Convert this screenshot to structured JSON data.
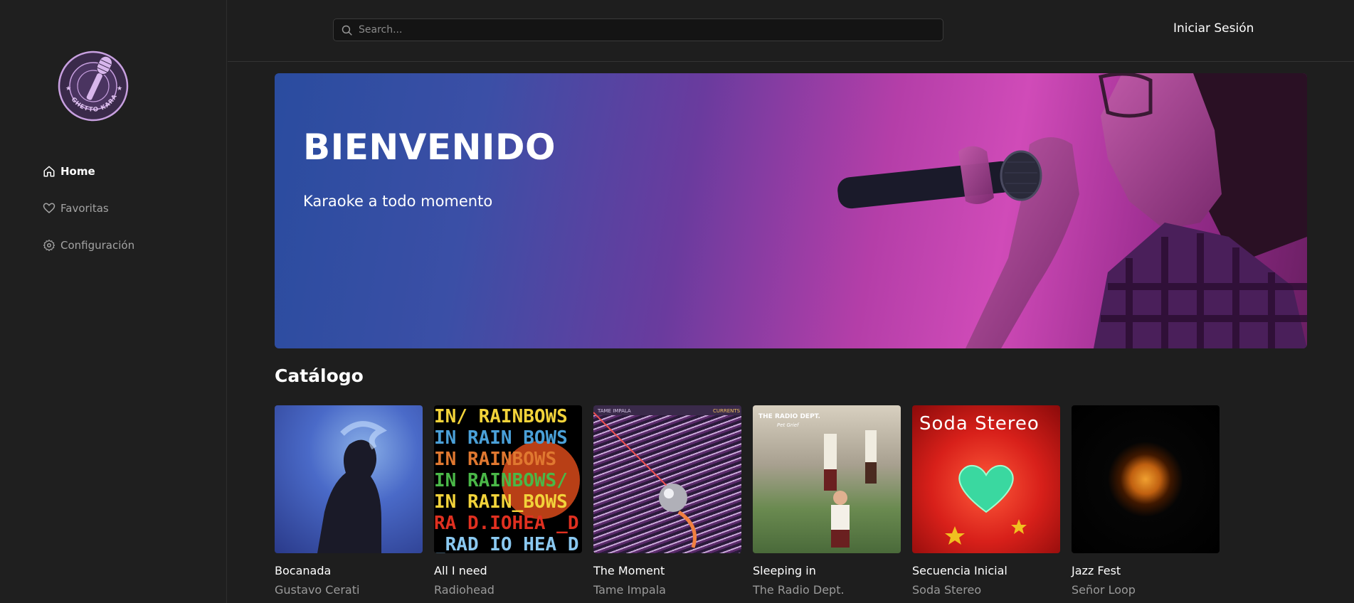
{
  "logo": {
    "ring_text": "GHETTO KARAOKE",
    "icon": "microphone-logo"
  },
  "sidebar": {
    "items": [
      {
        "label": "Home",
        "icon": "home-icon",
        "active": true
      },
      {
        "label": "Favoritas",
        "icon": "heart-icon",
        "active": false
      },
      {
        "label": "Configuración",
        "icon": "gear-icon",
        "active": false
      }
    ]
  },
  "header": {
    "search_placeholder": "Search...",
    "login_label": "Iniciar Sesión"
  },
  "hero": {
    "title": "BIENVENIDO",
    "subtitle": "Karaoke a todo momento"
  },
  "catalog": {
    "title": "Catálogo",
    "albums": [
      {
        "title": "Bocanada",
        "artist": "Gustavo Cerati"
      },
      {
        "title": "All I need",
        "artist": "Radiohead",
        "cover_text": [
          "IN/ RAINBOWS",
          "IN RAIN BOWS",
          "IN RAINBOWS",
          "IN RAINBOWS/",
          "IN RAIN_BOWS",
          "RA D.IOHEA _D",
          "_RAD IO HEA D"
        ]
      },
      {
        "title": "The Moment",
        "artist": "Tame Impala",
        "cover_text": [
          "TAME IMPALA",
          "CURRENTS"
        ]
      },
      {
        "title": "Sleeping in",
        "artist": "The Radio Dept.",
        "cover_text": [
          "THE RADIO DEPT.",
          "Pet Grief"
        ]
      },
      {
        "title": "Secuencia Inicial",
        "artist": "Soda Stereo",
        "cover_text": [
          "Soda Stereo"
        ]
      },
      {
        "title": "Jazz Fest",
        "artist": "Señor Loop"
      }
    ]
  },
  "colors": {
    "background": "#1e1e1e",
    "sidebar": "#1f1f1f",
    "accent": "#b98ad6",
    "muted": "#9a9a9a"
  }
}
